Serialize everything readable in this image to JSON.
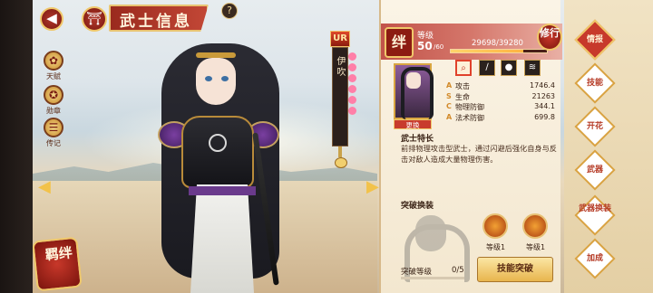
{
  "header": {
    "title": "武士信息",
    "back_icon": "back-arrow-icon",
    "home_icon": "home-icon",
    "help_label": "?"
  },
  "left_menu": [
    {
      "label": "天赋",
      "icon": "talent-icon"
    },
    {
      "label": "勋章",
      "icon": "medal-icon"
    },
    {
      "label": "传记",
      "icon": "biography-icon"
    }
  ],
  "character": {
    "rarity": "UR",
    "name": "伊吹",
    "star_count": 6
  },
  "bond_button": {
    "label": "羁绊"
  },
  "panel": {
    "bond_label": "绊",
    "level_label": "等级",
    "level_value": "50",
    "level_max": "/60",
    "exp_text": "29698/39280",
    "exp_progress": 0.756,
    "cultivate_label": "修行",
    "swap_label": "更换",
    "equipment": [
      {
        "icon": "search-icon",
        "active": true
      },
      {
        "icon": "blade-icon",
        "active": false
      },
      {
        "icon": "orb-icon",
        "active": false
      },
      {
        "icon": "claw-icon",
        "active": false
      }
    ],
    "stats": [
      {
        "name": "攻击",
        "value": "1746.4",
        "glyph": "A"
      },
      {
        "name": "生命",
        "value": "21263",
        "glyph": "S"
      },
      {
        "name": "物理防御",
        "value": "344.1",
        "glyph": "C"
      },
      {
        "name": "法术防御",
        "value": "699.8",
        "glyph": "A"
      }
    ],
    "trait_title": "武士特长",
    "trait_desc": "前排物理攻击型武士，通过闪避后强化自身与反击对敌人造成大量物理伤害。",
    "break_title": "突破换装",
    "skills": [
      {
        "level": "等级1"
      },
      {
        "level": "等级1"
      }
    ],
    "break_level_label": "突破等级",
    "break_count": "0/5",
    "skill_break_label": "技能突破"
  },
  "tabs": [
    {
      "label": "情报",
      "active": true
    },
    {
      "label": "技能",
      "active": false
    },
    {
      "label": "开花",
      "active": false
    },
    {
      "label": "武器",
      "active": false
    },
    {
      "label": "武器换装",
      "active": false
    },
    {
      "label": "加成",
      "active": false
    }
  ],
  "colors": {
    "accent_red": "#c7392b",
    "gold": "#f0c86a",
    "parchment": "#fbf4e6"
  }
}
